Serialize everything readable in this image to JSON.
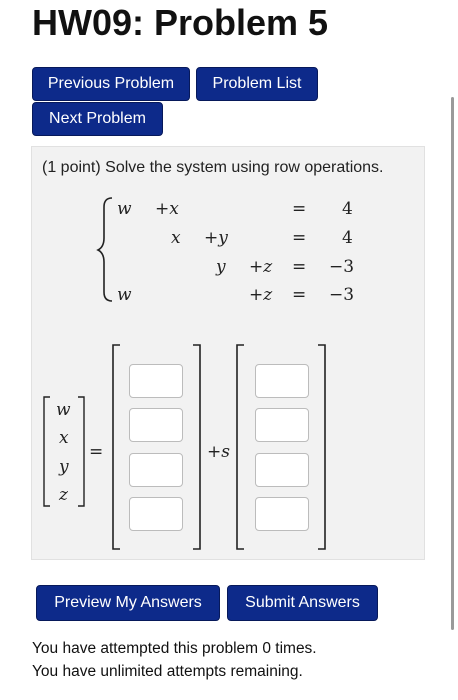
{
  "page_title": "HW09: Problem 5",
  "nav": {
    "previous_label": "Previous Problem",
    "list_label": "Problem List",
    "next_label": "Next Problem"
  },
  "problem": {
    "prompt": "(1 point) Solve the system using row operations.",
    "system": {
      "rows": [
        {
          "terms": [
            "w",
            "+x",
            "",
            "",
            "="
          ],
          "rhs": "4"
        },
        {
          "terms": [
            "",
            "x",
            "+y",
            "",
            "="
          ],
          "rhs": "4"
        },
        {
          "terms": [
            "",
            "",
            "y",
            "+z",
            "="
          ],
          "rhs": "−3"
        },
        {
          "terms": [
            "w",
            "",
            "",
            "+z",
            "="
          ],
          "rhs": "−3"
        }
      ]
    },
    "solution_vector": [
      "w",
      "x",
      "y",
      "z"
    ],
    "equals": "=",
    "param_term": "+s",
    "answer_fields": {
      "particular": [
        "",
        "",
        "",
        ""
      ],
      "direction": [
        "",
        "",
        "",
        ""
      ]
    }
  },
  "actions": {
    "preview_label": "Preview My Answers",
    "submit_label": "Submit Answers"
  },
  "status": {
    "attempts_text": "You have attempted this problem 0 times.",
    "remaining_text": "You have unlimited attempts remaining."
  },
  "colors": {
    "button_bg": "#0d2a8a",
    "panel_bg": "#f2f2f2"
  }
}
